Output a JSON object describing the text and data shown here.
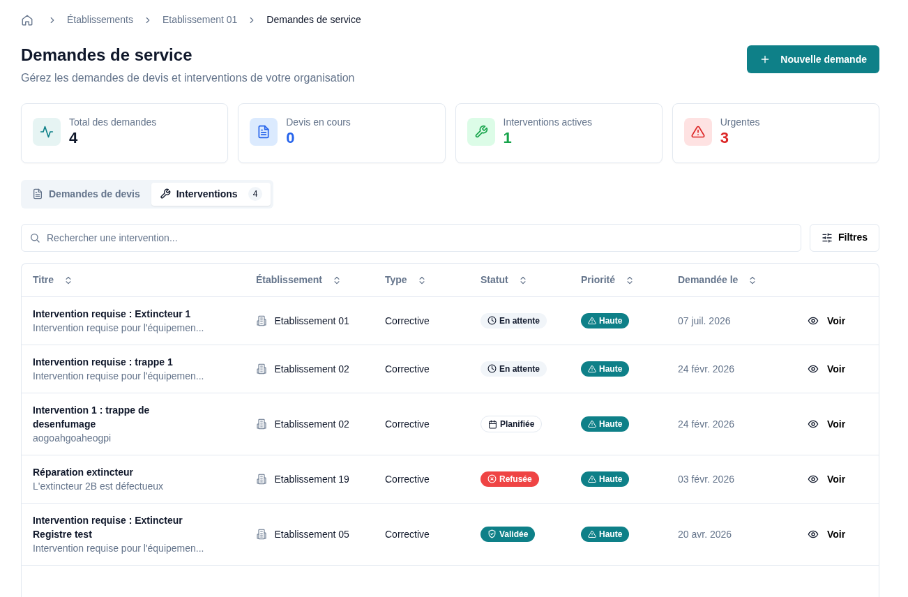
{
  "breadcrumb": [
    "Établissements",
    "Etablissement 01",
    "Demandes de service"
  ],
  "page": {
    "title": "Demandes de service",
    "subtitle": "Gérez les demandes de devis et interventions de votre organisation",
    "new_button": "Nouvelle demande"
  },
  "stats": [
    {
      "kind": "activity",
      "label": "Total des demandes",
      "value": "4",
      "color": "#0f172a"
    },
    {
      "kind": "document",
      "label": "Devis en cours",
      "value": "0",
      "color": "#2563eb"
    },
    {
      "kind": "wrench",
      "label": "Interventions actives",
      "value": "1",
      "color": "#16a34a"
    },
    {
      "kind": "warning",
      "label": "Urgentes",
      "value": "3",
      "color": "#dc2626"
    }
  ],
  "tabs": [
    {
      "kind": "document",
      "label": "Demandes de devis",
      "selected": false
    },
    {
      "kind": "wrench",
      "label": "Interventions",
      "count": "4",
      "selected": true
    }
  ],
  "search": {
    "placeholder": "Rechercher une intervention..."
  },
  "filter_button": "Filtres",
  "table": {
    "columns": [
      "Titre",
      "Établissement",
      "Type",
      "Statut",
      "Priorité",
      "Demandée le"
    ],
    "rows": [
      {
        "title": "Intervention requise : Extincteur 1",
        "description": "Intervention requise pour l'équipemen...",
        "site": "Etablissement 01",
        "type": "Corrective",
        "status": {
          "kind": "pending",
          "label": "En attente"
        },
        "priority": "Haute",
        "date": "07 juil. 2026",
        "action": "Voir"
      },
      {
        "title": "Intervention requise : trappe 1",
        "description": "Intervention requise pour l'équipemen...",
        "site": "Etablissement 02",
        "type": "Corrective",
        "status": {
          "kind": "pending",
          "label": "En attente"
        },
        "priority": "Haute",
        "date": "24 févr. 2026",
        "action": "Voir"
      },
      {
        "title": "Intervention 1 : trappe de desenfumage",
        "description": "aogoahgoaheogpi",
        "site": "Etablissement 02",
        "type": "Corrective",
        "status": {
          "kind": "planned",
          "label": "Planifiée"
        },
        "priority": "Haute",
        "date": "24 févr. 2026",
        "action": "Voir"
      },
      {
        "title": "Réparation extincteur",
        "description": "L'extincteur 2B est défectueux",
        "site": "Etablissement 19",
        "type": "Corrective",
        "status": {
          "kind": "refused",
          "label": "Refusée"
        },
        "priority": "Haute",
        "date": "03 févr. 2026",
        "action": "Voir"
      },
      {
        "title": "Intervention requise : Extincteur Registre test",
        "description": "Intervention requise pour l'équipemen...",
        "site": "Etablissement 05",
        "type": "Corrective",
        "status": {
          "kind": "validated",
          "label": "Validée"
        },
        "priority": "Haute",
        "date": "20 avr. 2026",
        "action": "Voir"
      }
    ]
  }
}
